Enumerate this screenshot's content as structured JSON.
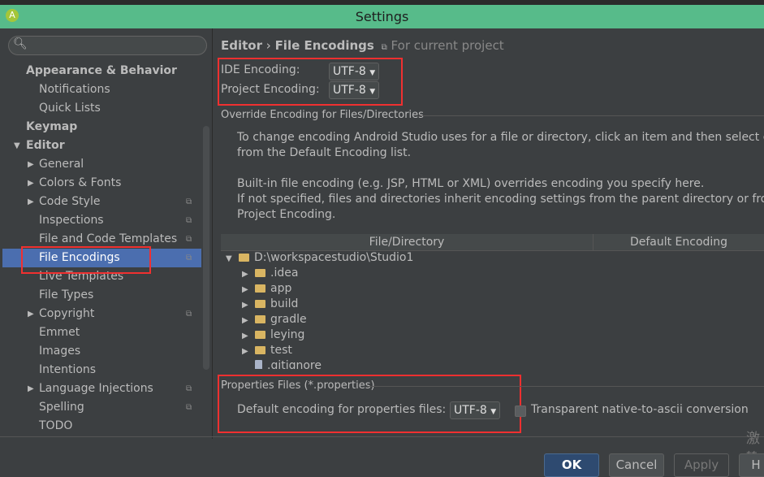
{
  "window": {
    "title": "Settings"
  },
  "search": {
    "placeholder": ""
  },
  "sidebar": {
    "items": [
      {
        "label": "Appearance & Behavior",
        "level": 0,
        "bold": true
      },
      {
        "label": "Notifications",
        "level": 1
      },
      {
        "label": "Quick Lists",
        "level": 1
      },
      {
        "label": "Keymap",
        "level": 0,
        "bold": true
      },
      {
        "label": "Editor",
        "level": 0,
        "bold": true,
        "expanded": true
      },
      {
        "label": "General",
        "level": 1,
        "arrow": true
      },
      {
        "label": "Colors & Fonts",
        "level": 1,
        "arrow": true
      },
      {
        "label": "Code Style",
        "level": 1,
        "arrow": true,
        "project": true
      },
      {
        "label": "Inspections",
        "level": 1,
        "project": true
      },
      {
        "label": "File and Code Templates",
        "level": 1,
        "project": true
      },
      {
        "label": "File Encodings",
        "level": 1,
        "project": true,
        "selected": true
      },
      {
        "label": "Live Templates",
        "level": 1
      },
      {
        "label": "File Types",
        "level": 1
      },
      {
        "label": "Copyright",
        "level": 1,
        "arrow": true,
        "project": true
      },
      {
        "label": "Emmet",
        "level": 1
      },
      {
        "label": "Images",
        "level": 1
      },
      {
        "label": "Intentions",
        "level": 1
      },
      {
        "label": "Language Injections",
        "level": 1,
        "arrow": true,
        "project": true
      },
      {
        "label": "Spelling",
        "level": 1,
        "project": true
      },
      {
        "label": "TODO",
        "level": 1
      }
    ]
  },
  "breadcrumb": {
    "parent": "Editor",
    "sep": "›",
    "current": "File Encodings",
    "scope": "For current project"
  },
  "encodings": {
    "ide_label": "IDE Encoding:",
    "ide_value": "UTF-8",
    "project_label": "Project Encoding:",
    "project_value": "UTF-8"
  },
  "override": {
    "title": "Override Encoding for Files/Directories",
    "line1": "To change encoding Android Studio uses for a file or directory, click an item and then select enco",
    "line2": "from the Default Encoding list.",
    "line3": "Built-in file encoding (e.g. JSP, HTML or XML) overrides encoding you specify here.",
    "line4": "If not specified, files and directories inherit encoding settings from the parent directory or from th",
    "line5": "Project Encoding."
  },
  "table": {
    "columns": [
      "File/Directory",
      "Default Encoding"
    ],
    "rows": [
      {
        "name": "D:\\workspacestudio\\Studio1",
        "expanded": true,
        "depth": 0,
        "type": "folder"
      },
      {
        "name": ".idea",
        "depth": 1,
        "type": "folder"
      },
      {
        "name": "app",
        "depth": 1,
        "type": "folder"
      },
      {
        "name": "build",
        "depth": 1,
        "type": "folder"
      },
      {
        "name": "gradle",
        "depth": 1,
        "type": "folder"
      },
      {
        "name": "leying",
        "depth": 1,
        "type": "folder"
      },
      {
        "name": "test",
        "depth": 1,
        "type": "folder"
      },
      {
        "name": ".gitignore",
        "depth": 1,
        "type": "file"
      }
    ]
  },
  "properties": {
    "title": "Properties Files (*.properties)",
    "label": "Default encoding for properties files:",
    "value": "UTF-8",
    "checkbox_label": "Transparent native-to-ascii conversion",
    "checked": false
  },
  "watermark": [
    "激",
    "转"
  ],
  "buttons": {
    "ok": "OK",
    "cancel": "Cancel",
    "apply": "Apply",
    "help": "H"
  },
  "colors": {
    "titlebar": "#57bb8a",
    "selection": "#4b6eaf",
    "highlight": "#f03030",
    "background": "#3c3f41"
  }
}
